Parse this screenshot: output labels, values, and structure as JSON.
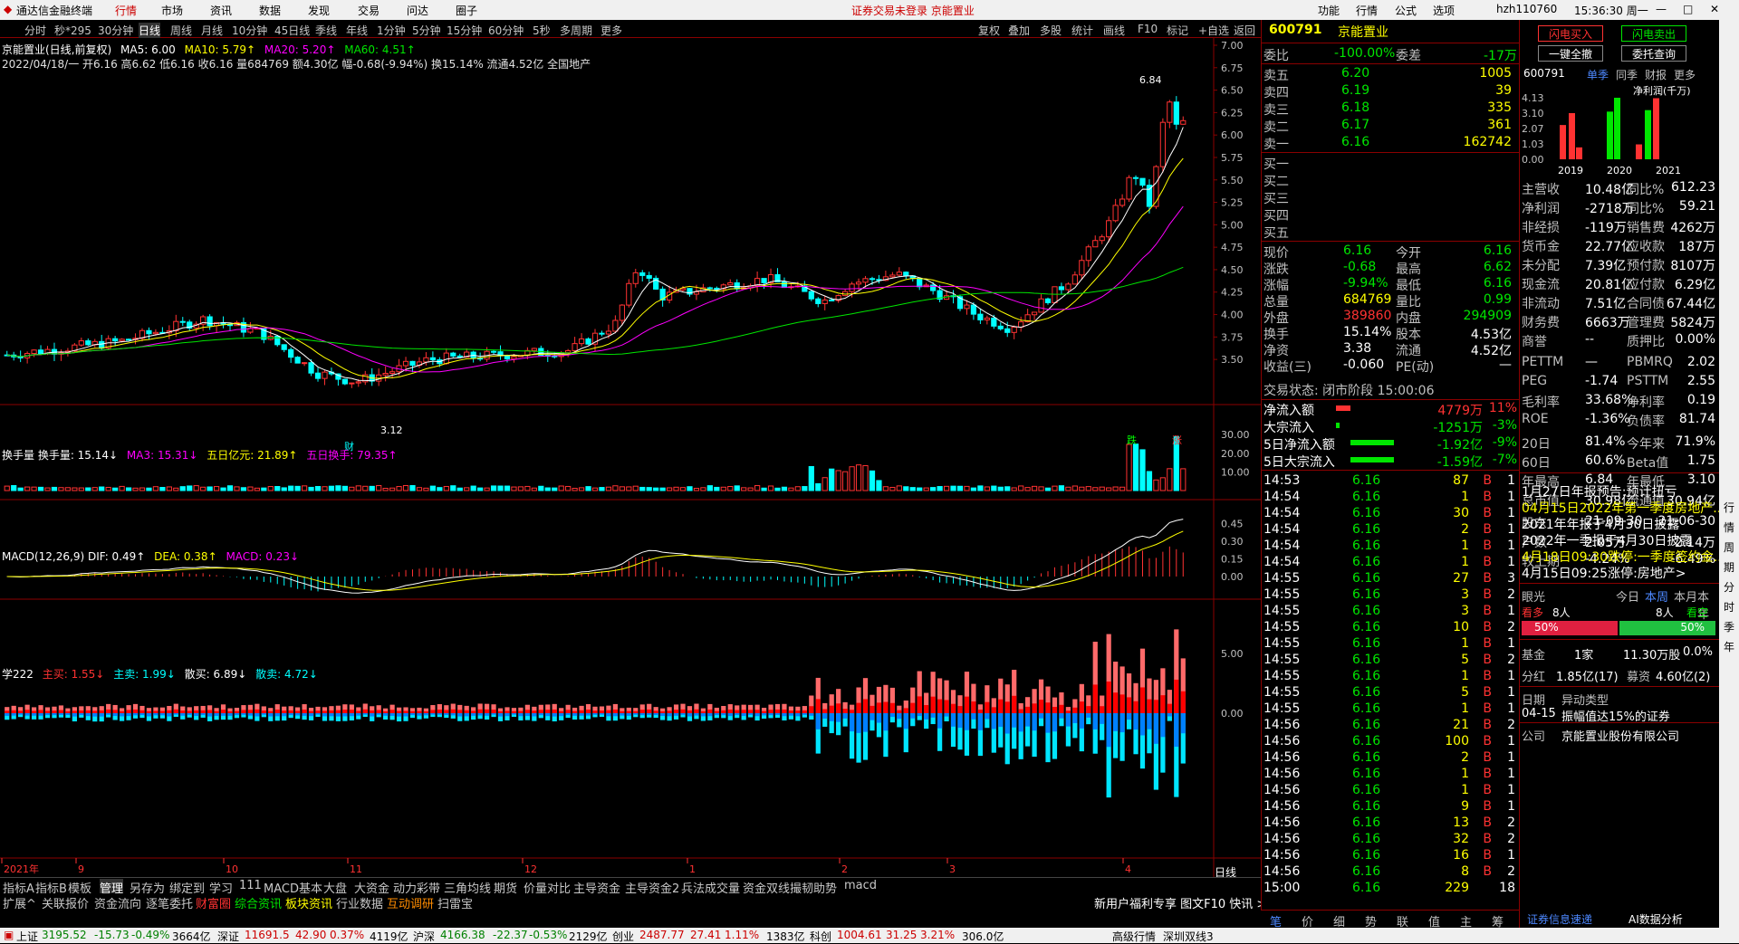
{
  "titlebar": {
    "app": "通达信金融终端",
    "menus": [
      "行情",
      "市场",
      "资讯",
      "数据",
      "发现",
      "交易",
      "问达",
      "圈子"
    ],
    "notice": "证券交易未登录  京能置业",
    "right": [
      "功能",
      "行情",
      "公式",
      "选项"
    ],
    "user": "hzh110760",
    "time": "15:36:30 周一"
  },
  "toolbar": {
    "periods": [
      "分时",
      "秒*295",
      "30分钟",
      "日线",
      "周线",
      "月线",
      "10分钟",
      "45日线",
      "季线",
      "年线",
      "1分钟",
      "5分钟",
      "15分钟",
      "60分钟",
      "5秒",
      "多周期",
      "更多"
    ],
    "actions": [
      "复权",
      "叠加",
      "多股",
      "统计",
      "画线",
      "F10",
      "标记",
      "+自选",
      "返回"
    ]
  },
  "main_header": {
    "line1": [
      {
        "t": "京能置业(日线,前复权)",
        "c": "white"
      },
      {
        "t": "MA5: 6.00",
        "c": "white"
      },
      {
        "t": "MA10: 5.79↑",
        "c": "yellow"
      },
      {
        "t": "MA20: 5.20↑",
        "c": "mag"
      },
      {
        "t": "MA60: 4.51↑",
        "c": "green"
      }
    ],
    "line2": "2022/04/18/一 开6.16 高6.62 低6.16 收6.16 量684769 额4.30亿 幅-0.68(-9.94%) 换15.14% 流通4.52亿 全国地产"
  },
  "price_axis": [
    "7.00",
    "6.75",
    "6.50",
    "6.25",
    "6.00",
    "5.75",
    "5.50",
    "5.25",
    "5.00",
    "4.75",
    "4.50",
    "4.25",
    "4.00",
    "3.75",
    "3.50"
  ],
  "annotations": {
    "high": "6.84",
    "low": "3.12",
    "cai": "财",
    "die": "跌",
    "zhang": "涨"
  },
  "vol_header": [
    {
      "t": "换手量 换手量: 15.14↓",
      "c": "white"
    },
    {
      "t": "MA3: 15.31↓",
      "c": "mag"
    },
    {
      "t": "五日亿元: 21.89↑",
      "c": "yellow"
    },
    {
      "t": "五日换手: 79.35↑",
      "c": "mag"
    }
  ],
  "vol_axis": [
    "30.00",
    "20.00",
    "10.00"
  ],
  "macd_header": [
    {
      "t": "MACD(12,26,9) DIF: 0.49↑",
      "c": "white"
    },
    {
      "t": "DEA: 0.38↑",
      "c": "yellow"
    },
    {
      "t": "MACD: 0.23↓",
      "c": "mag"
    }
  ],
  "macd_axis": [
    "0.45",
    "0.30",
    "0.15",
    "0.00"
  ],
  "xue_header": [
    {
      "t": "学222",
      "c": "white"
    },
    {
      "t": "主买: 1.55↓",
      "c": "red"
    },
    {
      "t": "主卖: 1.99↓",
      "c": "cyan"
    },
    {
      "t": "散买: 6.89↓",
      "c": "white"
    },
    {
      "t": "散卖: 4.72↓",
      "c": "cyan"
    }
  ],
  "xue_axis": [
    "5.00",
    "0.00"
  ],
  "x_axis": {
    "labels": [
      "2021年",
      "9",
      "10",
      "11",
      "12",
      "1",
      "2",
      "3",
      "4"
    ],
    "unit": "日线"
  },
  "bottom_tabs1": [
    "指标A",
    "指标B",
    "模板",
    "管理",
    "另存为",
    "绑定到",
    "学习",
    "111",
    "MACD基本",
    "大盘",
    "大资金",
    "动力彩带",
    "三角均线",
    "期货",
    "价量对比",
    "主导资金",
    "主导资金2",
    "兵法成交量",
    "资金双线撮韧",
    "助势",
    "macd"
  ],
  "bottom_tabs2": [
    "扩展^",
    "关联报价",
    "资金流向",
    "逐笔委托",
    "财富圈",
    "综合资讯",
    "板块资讯",
    "行业数据",
    "互动调研",
    "扫雷宝"
  ],
  "bottom_right": "新用户福利专享 图文F10 快讯 >>",
  "quote": {
    "code": "600791",
    "name": "京能置业",
    "weibi_l": "委比",
    "weibi": "-100.00%",
    "weicha_l": "委差",
    "weicha": "-17万",
    "sells": [
      {
        "l": "卖五",
        "p": "6.20",
        "v": "1005"
      },
      {
        "l": "卖四",
        "p": "6.19",
        "v": "39"
      },
      {
        "l": "卖三",
        "p": "6.18",
        "v": "335"
      },
      {
        "l": "卖二",
        "p": "6.17",
        "v": "361"
      },
      {
        "l": "卖一",
        "p": "6.16",
        "v": "162742"
      }
    ],
    "buys": [
      "买一",
      "买二",
      "买三",
      "买四",
      "买五"
    ],
    "stats": [
      [
        "现价",
        "6.16",
        "今开",
        "6.16"
      ],
      [
        "涨跌",
        "-0.68",
        "最高",
        "6.62"
      ],
      [
        "涨幅",
        "-9.94%",
        "最低",
        "6.16"
      ],
      [
        "总量",
        "684769",
        "量比",
        "0.99"
      ],
      [
        "外盘",
        "389860",
        "内盘",
        "294909"
      ],
      [
        "换手",
        "15.14%",
        "股本",
        "4.53亿"
      ],
      [
        "净资",
        "3.38",
        "流通",
        "4.52亿"
      ],
      [
        "收益(三)",
        "-0.060",
        "PE(动)",
        "—"
      ]
    ],
    "state": "交易状态: 闭市阶段 15:00:06",
    "flows": [
      [
        "净流入额",
        "4779万",
        "11%"
      ],
      [
        "大宗流入",
        "-1251万",
        "-3%"
      ],
      [
        "5日净流入额",
        "-1.92亿",
        "-9%"
      ],
      [
        "5日大宗流入",
        "-1.59亿",
        "-7%"
      ]
    ]
  },
  "ticks": [
    [
      "14:53",
      "6.16",
      "87",
      "B",
      "1"
    ],
    [
      "14:54",
      "6.16",
      "1",
      "B",
      "1"
    ],
    [
      "14:54",
      "6.16",
      "30",
      "B",
      "1"
    ],
    [
      "14:54",
      "6.16",
      "2",
      "B",
      "1"
    ],
    [
      "14:54",
      "6.16",
      "1",
      "B",
      "1"
    ],
    [
      "14:54",
      "6.16",
      "1",
      "B",
      "1"
    ],
    [
      "14:55",
      "6.16",
      "27",
      "B",
      "3"
    ],
    [
      "14:55",
      "6.16",
      "3",
      "B",
      "2"
    ],
    [
      "14:55",
      "6.16",
      "3",
      "B",
      "1"
    ],
    [
      "14:55",
      "6.16",
      "10",
      "B",
      "2"
    ],
    [
      "14:55",
      "6.16",
      "1",
      "B",
      "1"
    ],
    [
      "14:55",
      "6.16",
      "5",
      "B",
      "2"
    ],
    [
      "14:55",
      "6.16",
      "1",
      "B",
      "1"
    ],
    [
      "14:55",
      "6.16",
      "5",
      "B",
      "1"
    ],
    [
      "14:55",
      "6.16",
      "1",
      "B",
      "1"
    ],
    [
      "14:56",
      "6.16",
      "21",
      "B",
      "2"
    ],
    [
      "14:56",
      "6.16",
      "100",
      "B",
      "1"
    ],
    [
      "14:56",
      "6.16",
      "2",
      "B",
      "1"
    ],
    [
      "14:56",
      "6.16",
      "1",
      "B",
      "1"
    ],
    [
      "14:56",
      "6.16",
      "1",
      "B",
      "1"
    ],
    [
      "14:56",
      "6.16",
      "9",
      "B",
      "1"
    ],
    [
      "14:56",
      "6.16",
      "13",
      "B",
      "2"
    ],
    [
      "14:56",
      "6.16",
      "32",
      "B",
      "2"
    ],
    [
      "14:56",
      "6.16",
      "16",
      "B",
      "1"
    ],
    [
      "14:56",
      "6.16",
      "8",
      "B",
      "2"
    ],
    [
      "15:00",
      "6.16",
      "229",
      "",
      "18"
    ]
  ],
  "rbottom_tabs": [
    "笔",
    "价",
    "细",
    "势",
    "联",
    "值",
    "主",
    "筹"
  ],
  "far": {
    "btn1": "闪电买入",
    "btn2": "闪电卖出",
    "btn3": "一键全撤",
    "btn4": "委托查询",
    "code": "600791",
    "tabs": [
      "单季",
      "同季",
      "财报",
      "更多"
    ],
    "profit_label": "净利润(千万)",
    "profit_axis": [
      "4.13",
      "3.10",
      "2.07",
      "1.03",
      "0.00"
    ],
    "years": [
      "2019",
      "2020",
      "2021"
    ],
    "fin": [
      [
        "主营收",
        "10.48亿",
        "同比%",
        "612.23"
      ],
      [
        "净利润",
        "-2718万",
        "同比%",
        "59.21"
      ],
      [
        "非经损",
        "-119万",
        "销售费",
        "4262万"
      ],
      [
        "货币金",
        "22.77亿",
        "应收款",
        "187万"
      ],
      [
        "未分配",
        "7.39亿",
        "预付款",
        "8107万"
      ],
      [
        "现金流",
        "20.81亿",
        "应付款",
        "6.29亿"
      ],
      [
        "非流动",
        "7.51亿",
        "合同债",
        "67.44亿"
      ],
      [
        "财务费",
        "6663万",
        "管理费",
        "5824万"
      ],
      [
        "商誉",
        "--",
        "质押比",
        "0.00%"
      ],
      [
        "PETTM",
        "—",
        "PBMRQ",
        "2.02"
      ],
      [
        "PEG",
        "-1.74",
        "PSTTM",
        "2.55"
      ],
      [
        "毛利率",
        "33.68%",
        "净利率",
        "0.19"
      ],
      [
        "ROE",
        "-1.36%",
        "负债率",
        "81.74"
      ],
      [
        "20日",
        "81.4%",
        "今年来",
        "71.9%"
      ],
      [
        "60日",
        "60.6%",
        "Beta值",
        "1.75"
      ],
      [
        "年最高",
        "6.84",
        "年最低",
        "3.10"
      ],
      [
        "总市值",
        "30.98亿",
        "流通值",
        "30.94亿"
      ],
      [
        "股东",
        "21-09-30",
        "",
        "21-06-30"
      ],
      [
        "户数",
        "2.05万",
        "",
        "2.14万"
      ],
      [
        "较上期",
        "-4.24%",
        "",
        "-6.49%"
      ]
    ],
    "news": [
      {
        "t": "1月27日年报预告:预计扭亏",
        "c": "white"
      },
      {
        "t": "04月15日2022年第一季度房地产...",
        "c": "yellow"
      },
      {
        "t": "2021年年报于4月30日披露",
        "c": "white"
      },
      {
        "t": "2022年一季报于4月30日披露",
        "c": "white"
      },
      {
        "t": "4月18日09:30跌停:一季度签约金...",
        "c": "yellow"
      },
      {
        "t": "4月15日09:25涨停:房地产>",
        "c": "white"
      }
    ],
    "eye": {
      "label": "眼光",
      "tabs": [
        "今日",
        "本周",
        "本月",
        "本年"
      ],
      "bull": "看多",
      "bull_n": "8人",
      "bear_n": "8人",
      "bear": "看空",
      "bull_pct": "50%",
      "bear_pct": "50%"
    },
    "fund": [
      "基金",
      "1家",
      "11.30万股",
      "0.0%"
    ],
    "fenhong": [
      "分红",
      "1.85亿(17)",
      "募资",
      "4.60亿(2)"
    ],
    "date_row": [
      "日期",
      "异动类型"
    ],
    "yidong": [
      "04-15",
      "振幅值达15%的证券"
    ],
    "company": [
      "公司",
      "京能置业股份有限公司"
    ],
    "links": [
      "证券信息速递",
      "AI数据分析"
    ]
  },
  "strip": [
    "行",
    "情",
    "周",
    "期",
    "分",
    "时",
    "季",
    "年"
  ],
  "status": {
    "sh": [
      "上证",
      "3195.52",
      "-15.73",
      "-0.49%",
      "3664亿"
    ],
    "sz": [
      "深证",
      "11691.5",
      "42.90",
      "0.37%",
      "4119亿"
    ],
    "hs": [
      "沪深",
      "4166.38",
      "-22.37",
      "-0.53%",
      "2129亿"
    ],
    "cy": [
      "创业",
      "2487.77",
      "27.41",
      "1.11%",
      "1383亿"
    ],
    "kc": [
      "科创",
      "1004.61",
      "31.25",
      "3.21%",
      "306.0亿"
    ],
    "right": [
      "高级行情",
      "深圳双线3"
    ]
  },
  "chart_data": {
    "type": "candlestick",
    "series": "京能置业 日线 前复权",
    "ylim": [
      3.35,
      7.0
    ],
    "candles_note": "approximate 2021-08 to 2022-04-18"
  }
}
